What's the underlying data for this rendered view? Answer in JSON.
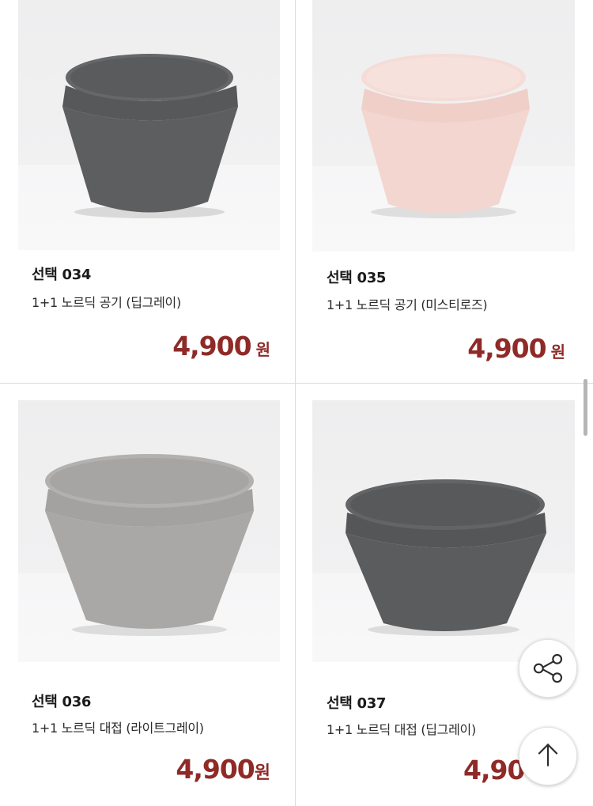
{
  "products": [
    {
      "code": "선택 034",
      "name": "1+1 노르딕 공기 (딥그레이)",
      "price": "4,900",
      "unit": "원",
      "bowl_color": "#5d5e60",
      "bowl_inner": "#6a6b6d"
    },
    {
      "code": "선택 035",
      "name": "1+1 노르딕 공기 (미스티로즈)",
      "price": "4,900",
      "unit": "원",
      "bowl_color": "#f3d6cf",
      "bowl_inner": "#f6ddd7"
    },
    {
      "code": "선택 036",
      "name": "1+1 노르딕 대접 (라이트그레이)",
      "price": "4,900",
      "unit": "원",
      "bowl_color": "#a9a8a6",
      "bowl_inner": "#b4b3b1"
    },
    {
      "code": "선택 037",
      "name": "1+1 노르딕 대접 (딥그레이)",
      "price": "4,90",
      "unit": "",
      "bowl_color": "#5b5c5e",
      "bowl_inner": "#67686a"
    }
  ],
  "colors": {
    "price": "#8f2a27",
    "divider": "#dcdcdc"
  },
  "floating": {
    "share_icon": "share-icon",
    "top_icon": "arrow-up-icon"
  }
}
